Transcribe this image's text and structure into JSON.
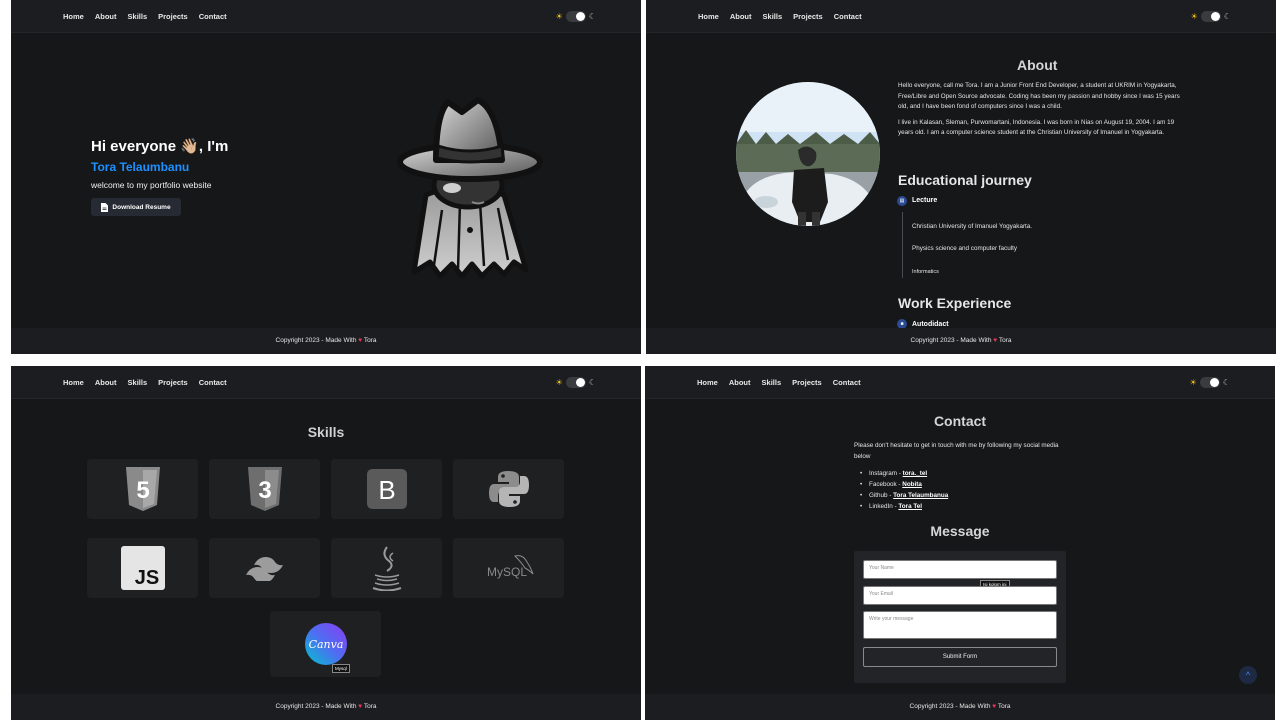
{
  "nav": {
    "links": [
      "Home",
      "About",
      "Skills",
      "Projects",
      "Contact"
    ],
    "theme_sun": "☀",
    "theme_moon": "☾"
  },
  "footer": {
    "text_before": "Copyright 2023 - Made With",
    "text_after": "Tora",
    "heart": "♥"
  },
  "hero": {
    "greeting": "Hi everyone 👋🏼, I'm",
    "name": "Tora Telaumbanu",
    "subtitle": "welcome to my portfolio website",
    "download_button": "Download Resume"
  },
  "about": {
    "title": "About",
    "paragraph_1": "Hello everyone, call me Tora. I am a Junior Front End Developer, a student at UKRIM in Yogyakarta, Free/Libre and Open Source advocate. Coding has been my passion and hobby since I was 15 years old, and I have been fond of computers since I was a child.",
    "paragraph_2": "I live in Kalasan, Sleman, Purwomartani, Indonesia. I was born in Nias on August 19, 2004. I am 19 years old. I am a computer science student at the Christian University of Imanuel in Yogyakarta.",
    "education_title": "Educational journey",
    "education_head": "Lecture",
    "education_items": [
      "Christian University of Imanuel Yogyakarta.",
      "Physics science and computer faculty",
      "Informatics"
    ],
    "work_title": "Work Experience",
    "work_head": "Autodidact"
  },
  "skills": {
    "title": "Skills",
    "items": [
      "html5-icon",
      "css3-icon",
      "bootstrap-icon",
      "python-icon",
      "javascript-icon",
      "tailwind-icon",
      "java-icon",
      "mysql-icon",
      "canva-icon"
    ],
    "js_text": "JS",
    "bootstrap_text": "B",
    "mysql_text": "MySQL",
    "canva_text": "Canva",
    "tooltip": "Mysql"
  },
  "contact": {
    "title": "Contact",
    "intro": "Please don't hesitate to get in touch with me by following my social media below",
    "social": [
      {
        "platform": "Instagram",
        "handle": "tora._tel"
      },
      {
        "platform": "Facebook",
        "handle": "Nobita"
      },
      {
        "platform": "Github",
        "handle": "Tora Telaumbanua"
      },
      {
        "platform": "LinkedIn",
        "handle": "Tora Tel"
      }
    ],
    "message_title": "Message",
    "name_placeholder": "Your Name",
    "email_placeholder": "Your Email",
    "message_placeholder": "Write your message",
    "autofill_tooltip": "Isi kolom ini",
    "submit_label": "Submit Form",
    "scroll_top_icon": "^"
  },
  "colors": {
    "background": "#161719",
    "navbar": "#1c1d20",
    "accent_blue": "#1e90ff",
    "heart": "#e8365d"
  }
}
